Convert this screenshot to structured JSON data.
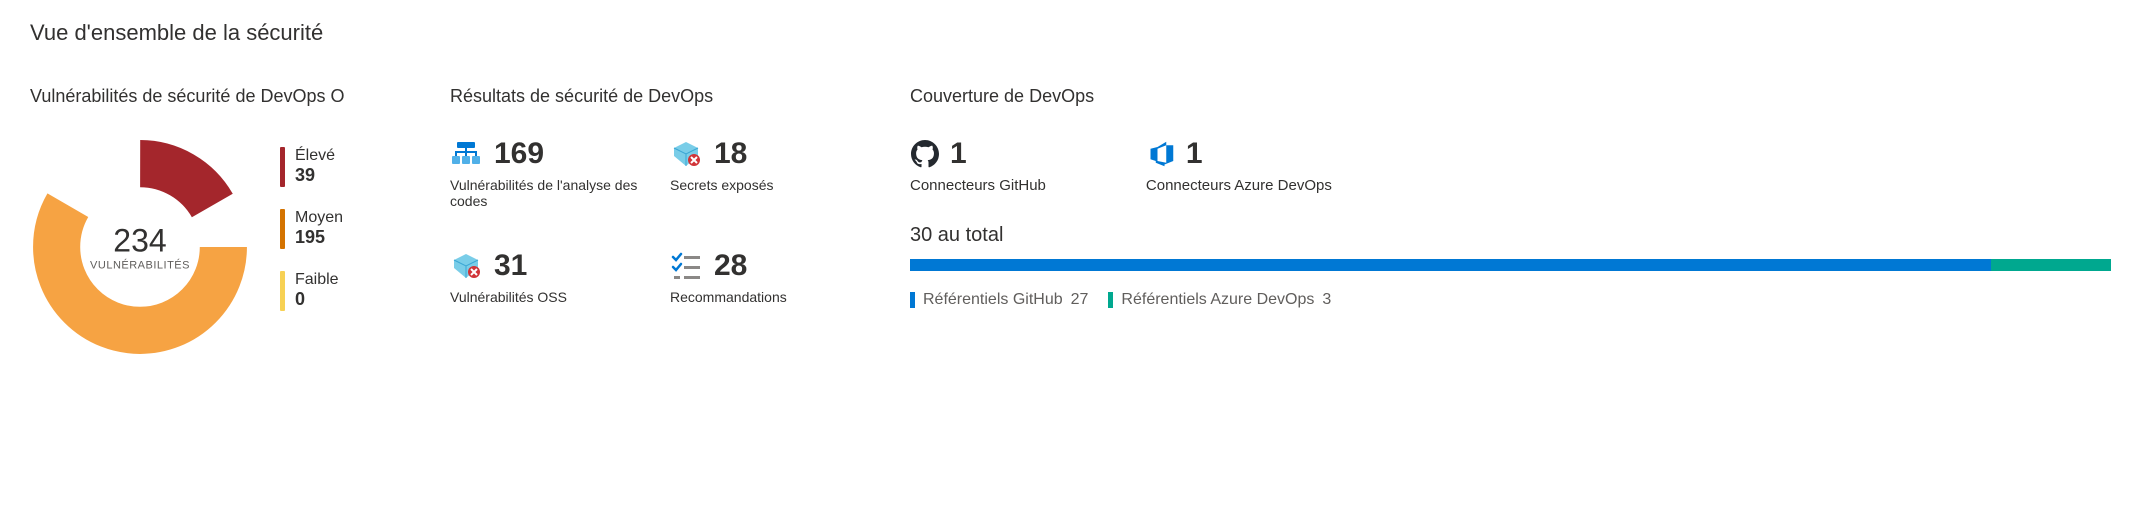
{
  "page_title": "Vue d'ensemble de la sécurité",
  "vuln": {
    "title": "Vulnérabilités de sécurité de DevOps O",
    "center_value": "234",
    "center_label": "VULNÉRABILITÉS",
    "legend": [
      {
        "label": "Élevé",
        "value": "39",
        "color": "#a4262c"
      },
      {
        "label": "Moyen",
        "value": "195",
        "color": "#d47300"
      },
      {
        "label": "Faible",
        "value": "0",
        "color": "#f7d154"
      }
    ]
  },
  "results": {
    "title": "Résultats de sécurité de DevOps",
    "metrics": [
      {
        "icon": "code-scan-icon",
        "value": "169",
        "label": "Vulnérabilités de l'analyse des codes"
      },
      {
        "icon": "secret-icon",
        "value": "18",
        "label": "Secrets exposés"
      },
      {
        "icon": "oss-vuln-icon",
        "value": "31",
        "label": "Vulnérabilités OSS"
      },
      {
        "icon": "recommendations-icon",
        "value": "28",
        "label": "Recommandations"
      }
    ]
  },
  "coverage": {
    "title": "Couverture de DevOps",
    "connectors": [
      {
        "icon": "github-icon",
        "value": "1",
        "label": "Connecteurs GitHub"
      },
      {
        "icon": "azure-devops-icon",
        "value": "1",
        "label": "Connecteurs Azure DevOps"
      }
    ],
    "total_label": "30 au total",
    "bar": [
      {
        "color": "#0078d4",
        "percent": 90
      },
      {
        "color": "#00a88f",
        "percent": 10
      }
    ],
    "legend": [
      {
        "color": "#0078d4",
        "label": "Référentiels GitHub",
        "value": "27"
      },
      {
        "color": "#00a88f",
        "label": "Référentiels Azure DevOps",
        "value": "3"
      }
    ]
  },
  "chart_data": [
    {
      "type": "pie",
      "title": "Vulnérabilités de sécurité de DevOps",
      "total": 234,
      "categories": [
        "Élevé",
        "Moyen",
        "Faible"
      ],
      "values": [
        39,
        195,
        0
      ],
      "colors": [
        "#a4262c",
        "#d47300",
        "#f7d154"
      ],
      "center_label": "VULNÉRABILITÉS"
    },
    {
      "type": "bar",
      "title": "Couverture de DevOps — 30 au total",
      "categories": [
        "Référentiels GitHub",
        "Référentiels Azure DevOps"
      ],
      "values": [
        27,
        3
      ],
      "colors": [
        "#0078d4",
        "#00a88f"
      ],
      "ylim": [
        0,
        30
      ]
    }
  ]
}
